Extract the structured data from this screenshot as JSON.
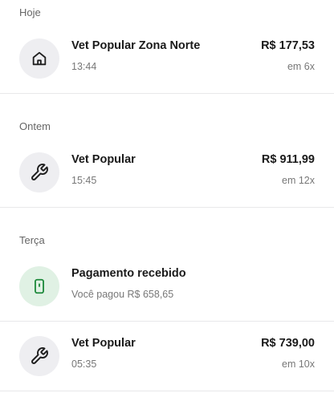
{
  "sections": [
    {
      "label": "Hoje",
      "items": [
        {
          "icon": "house-icon",
          "title": "Vet Popular Zona Norte",
          "subtitle": "13:44",
          "amount": "R$ 177,53",
          "installments": "em 6x"
        }
      ]
    },
    {
      "label": "Ontem",
      "items": [
        {
          "icon": "wrench-icon",
          "title": "Vet Popular",
          "subtitle": "15:45",
          "amount": "R$ 911,99",
          "installments": "em 12x"
        }
      ]
    },
    {
      "label": "Terça",
      "items": [
        {
          "icon": "phone-icon",
          "title": "Pagamento recebido",
          "subtitle": "Você pagou R$ 658,65",
          "amount": "",
          "installments": ""
        },
        {
          "icon": "wrench-icon",
          "title": "Vet Popular",
          "subtitle": "05:35",
          "amount": "R$ 739,00",
          "installments": "em 10x"
        }
      ]
    }
  ],
  "colors": {
    "icon_background": "#eeeef1",
    "success_background": "#e0f1e4",
    "success_icon": "#1e8a3c",
    "text_primary": "#1a1a1a",
    "text_secondary": "#777777"
  }
}
